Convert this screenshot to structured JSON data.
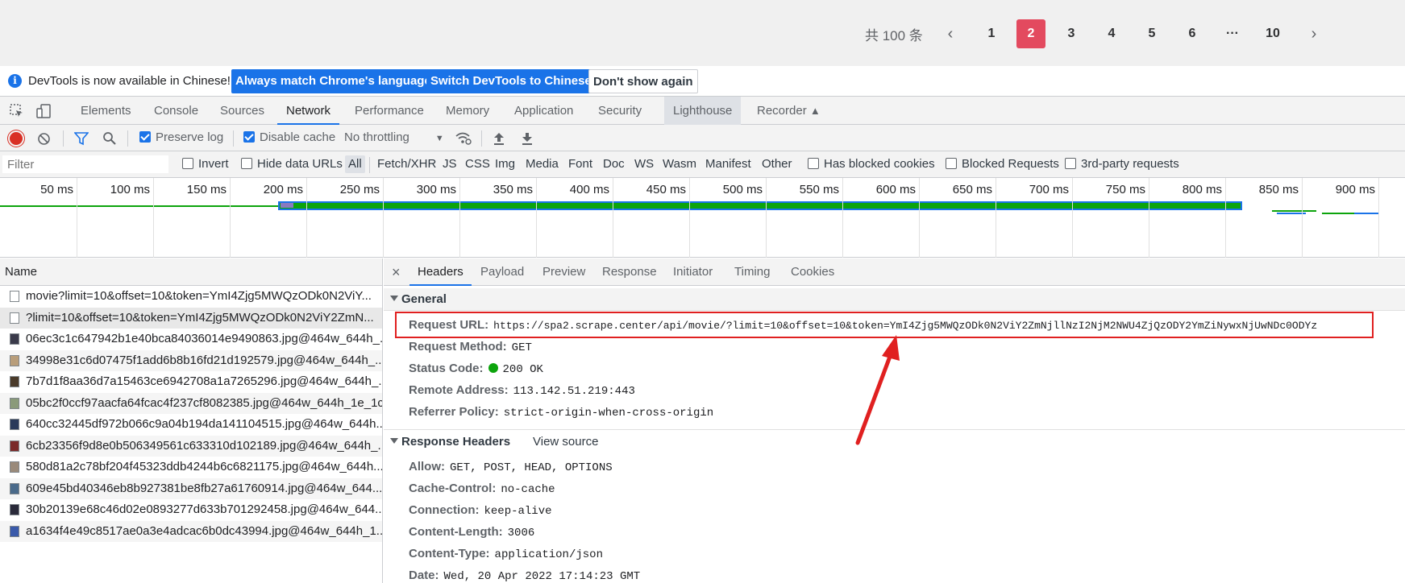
{
  "pagination": {
    "total": "共 100 条",
    "prev": "‹",
    "next": "›",
    "pages": [
      "1",
      "2",
      "3",
      "4",
      "5",
      "6",
      "···",
      "10"
    ],
    "active_page": "2"
  },
  "infobar": {
    "message": "DevTools is now available in Chinese!",
    "btn_match": "Always match Chrome's language",
    "btn_switch": "Switch DevTools to Chinese",
    "btn_dont_show": "Don't show again"
  },
  "tabs": [
    "Elements",
    "Console",
    "Sources",
    "Network",
    "Performance",
    "Memory",
    "Application",
    "Security",
    "Lighthouse",
    "Recorder"
  ],
  "selected_tab": "Network",
  "network_toolbar": {
    "preserve_log": "Preserve log",
    "disable_cache": "Disable cache",
    "throttling": "No throttling"
  },
  "filter_bar": {
    "placeholder": "Filter",
    "invert": "Invert",
    "hide_data_urls": "Hide data URLs",
    "types": [
      "All",
      "Fetch/XHR",
      "JS",
      "CSS",
      "Img",
      "Media",
      "Font",
      "Doc",
      "WS",
      "Wasm",
      "Manifest",
      "Other"
    ],
    "has_blocked_cookies": "Has blocked cookies",
    "blocked_requests": "Blocked Requests",
    "third_party": "3rd-party requests"
  },
  "timeline": {
    "labels": [
      "50 ms",
      "100 ms",
      "150 ms",
      "200 ms",
      "250 ms",
      "300 ms",
      "350 ms",
      "400 ms",
      "450 ms",
      "500 ms",
      "550 ms",
      "600 ms",
      "650 ms",
      "700 ms",
      "750 ms",
      "800 ms",
      "850 ms",
      "900 ms"
    ]
  },
  "requests": {
    "header": "Name",
    "rows": [
      "movie?limit=10&offset=10&token=YmI4Zjg5MWQzODk0N2ViY...",
      "?limit=10&offset=10&token=YmI4Zjg5MWQzODk0N2ViY2ZmN...",
      "06ec3c1c647942b1e40bca84036014e9490863.jpg@464w_644h_...",
      "34998e31c6d07475f1add6b8b16fd21d192579.jpg@464w_644h_...",
      "7b7d1f8aa36d7a15463ce6942708a1a7265296.jpg@464w_644h_...",
      "05bc2f0ccf97aacfa64fcac4f237cf8082385.jpg@464w_644h_1e_1c",
      "640cc32445df972b066c9a04b194da141104515.jpg@464w_644h...",
      "6cb23356f9d8e0b506349561c633310d102189.jpg@464w_644h_...",
      "580d81a2c78bf204f45323ddb4244b6c6821175.jpg@464w_644h...",
      "609e45bd40346eb8b927381be8fb27a61760914.jpg@464w_644...",
      "30b20139e68c46d02e0893277d633b701292458.jpg@464w_644...",
      "a1634f4e49c8517ae0a3e4adcac6b0dc43994.jpg@464w_644h_1..."
    ]
  },
  "details": {
    "close": "×",
    "tabs": [
      "Headers",
      "Payload",
      "Preview",
      "Response",
      "Initiator",
      "Timing",
      "Cookies"
    ],
    "selected_tab": "Headers",
    "general_title": "General",
    "general": [
      {
        "key": "Request URL:",
        "value": "https://spa2.scrape.center/api/movie/?limit=10&offset=10&token=YmI4Zjg5MWQzODk0N2ViY2ZmNjllNzI2NjM2NWU4ZjQzODY2YmZiNywxNjUwNDc0ODYz"
      },
      {
        "key": "Request Method:",
        "value": "GET"
      },
      {
        "key": "Status Code:",
        "value": "200 OK"
      },
      {
        "key": "Remote Address:",
        "value": "113.142.51.219:443"
      },
      {
        "key": "Referrer Policy:",
        "value": "strict-origin-when-cross-origin"
      }
    ],
    "response_title": "Response Headers",
    "view_source": "View source",
    "response": [
      {
        "key": "Allow:",
        "value": "GET, POST, HEAD, OPTIONS"
      },
      {
        "key": "Cache-Control:",
        "value": "no-cache"
      },
      {
        "key": "Connection:",
        "value": "keep-alive"
      },
      {
        "key": "Content-Length:",
        "value": "3006"
      },
      {
        "key": "Content-Type:",
        "value": "application/json"
      },
      {
        "key": "Date:",
        "value": "Wed, 20 Apr 2022 17:14:23 GMT"
      }
    ]
  },
  "colors": {
    "accent": "#1a73e8",
    "pager_active": "#e34a5f",
    "annotation": "#e02020",
    "status_ok": "#0ca40c"
  }
}
